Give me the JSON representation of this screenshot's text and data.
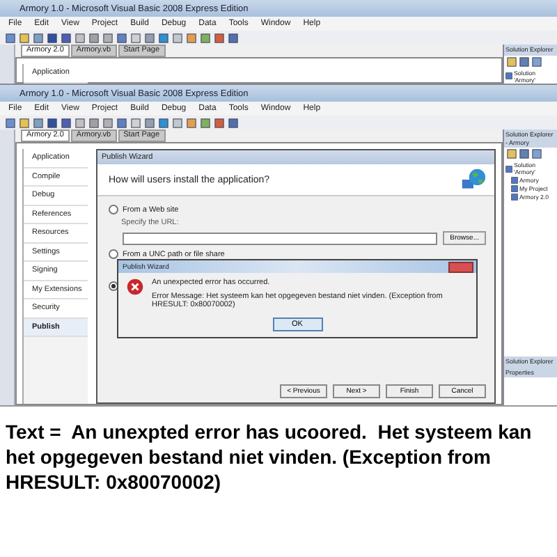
{
  "windows": [
    {
      "title": "Armory 1.0 - Microsoft Visual Basic 2008 Express Edition",
      "menu": [
        "File",
        "Edit",
        "View",
        "Project",
        "Build",
        "Debug",
        "Data",
        "Tools",
        "Window",
        "Help"
      ],
      "tabs": [
        {
          "label": "Armory 2.0",
          "selected": true
        },
        {
          "label": "Armory.vb",
          "selected": false
        },
        {
          "label": "Start Page",
          "selected": false
        }
      ],
      "sidebar_items": [
        {
          "label": "Application",
          "selected": false
        }
      ],
      "panel_title": "Solution Explorer",
      "tree": [
        "Solution 'Armory'"
      ]
    },
    {
      "title": "Armory 1.0 - Microsoft Visual Basic 2008 Express Edition",
      "menu": [
        "File",
        "Edit",
        "View",
        "Project",
        "Build",
        "Debug",
        "Data",
        "Tools",
        "Window",
        "Help"
      ],
      "tabs": [
        {
          "label": "Armory 2.0",
          "selected": true
        },
        {
          "label": "Armory.vb",
          "selected": false
        },
        {
          "label": "Start Page",
          "selected": false
        }
      ],
      "sidebar_items": [
        {
          "label": "Application",
          "selected": false
        },
        {
          "label": "Compile",
          "selected": false
        },
        {
          "label": "Debug",
          "selected": false
        },
        {
          "label": "References",
          "selected": false
        },
        {
          "label": "Resources",
          "selected": false
        },
        {
          "label": "Settings",
          "selected": false
        },
        {
          "label": "Signing",
          "selected": false
        },
        {
          "label": "My Extensions",
          "selected": false
        },
        {
          "label": "Security",
          "selected": false
        },
        {
          "label": "Publish",
          "selected": true
        }
      ],
      "panel_title": "Solution Explorer - Armory",
      "tree": [
        "Solution 'Armory'",
        "Armory",
        "My Project",
        "Armory 2.0"
      ],
      "panel2_title": "Solution Explorer",
      "panel3_title": "Properties"
    }
  ],
  "wizard": {
    "title": "Publish Wizard",
    "question": "How will users install the application?",
    "options": [
      {
        "label": "From a Web site",
        "hint": "Specify the URL:",
        "selected": false
      },
      {
        "label": "From a UNC path or file share",
        "selected": false
      },
      {
        "selected": true
      }
    ],
    "browse": "Browse...",
    "buttons": [
      "< Previous",
      "Next >",
      "Finish",
      "Cancel"
    ]
  },
  "error_dialog": {
    "title": "Publish Wizard",
    "message": "An unexpected error has occurred.",
    "detail": "Error Message: Het systeem kan het opgegeven bestand niet vinden. (Exception from HRESULT: 0x80070002)",
    "button": "OK"
  },
  "caption": "Text =  An unexpted error has ucoored.  Het systeem kan het opgegeven bestand niet vinden. (Exception from HRESULT: 0x80070002)"
}
